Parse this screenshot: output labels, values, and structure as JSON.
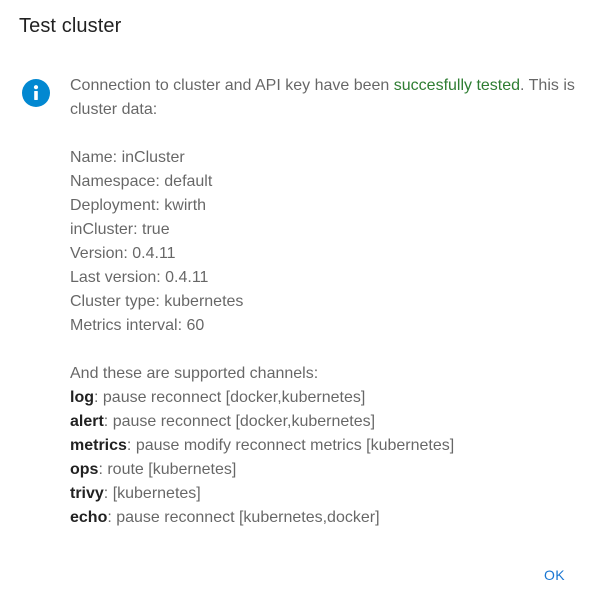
{
  "dialog": {
    "title": "Test cluster",
    "intro_prefix": "Connection to cluster and API key have been ",
    "intro_highlight": "succesfully tested",
    "intro_suffix": ". This is cluster data:",
    "cluster_info": [
      "Name: inCluster",
      "Namespace: default",
      "Deployment: kwirth",
      "inCluster: true",
      "Version: 0.4.11",
      "Last version: 0.4.11",
      "Cluster type: kubernetes",
      "Metrics interval: 60"
    ],
    "channels_heading": "And these are supported channels:",
    "channels": [
      {
        "name": "log",
        "details": ": pause reconnect [docker,kubernetes]"
      },
      {
        "name": "alert",
        "details": ": pause reconnect [docker,kubernetes]"
      },
      {
        "name": "metrics",
        "details": ": pause modify reconnect metrics [kubernetes]"
      },
      {
        "name": "ops",
        "details": ": route [kubernetes]"
      },
      {
        "name": "trivy",
        "details": ": [kubernetes]"
      },
      {
        "name": "echo",
        "details": ": pause reconnect [kubernetes,docker]"
      }
    ],
    "ok_label": "OK"
  },
  "colors": {
    "accent": "#1976d2",
    "info_icon": "#0288d1",
    "success": "#2e7d32"
  },
  "icons": {
    "info": "info-icon"
  }
}
